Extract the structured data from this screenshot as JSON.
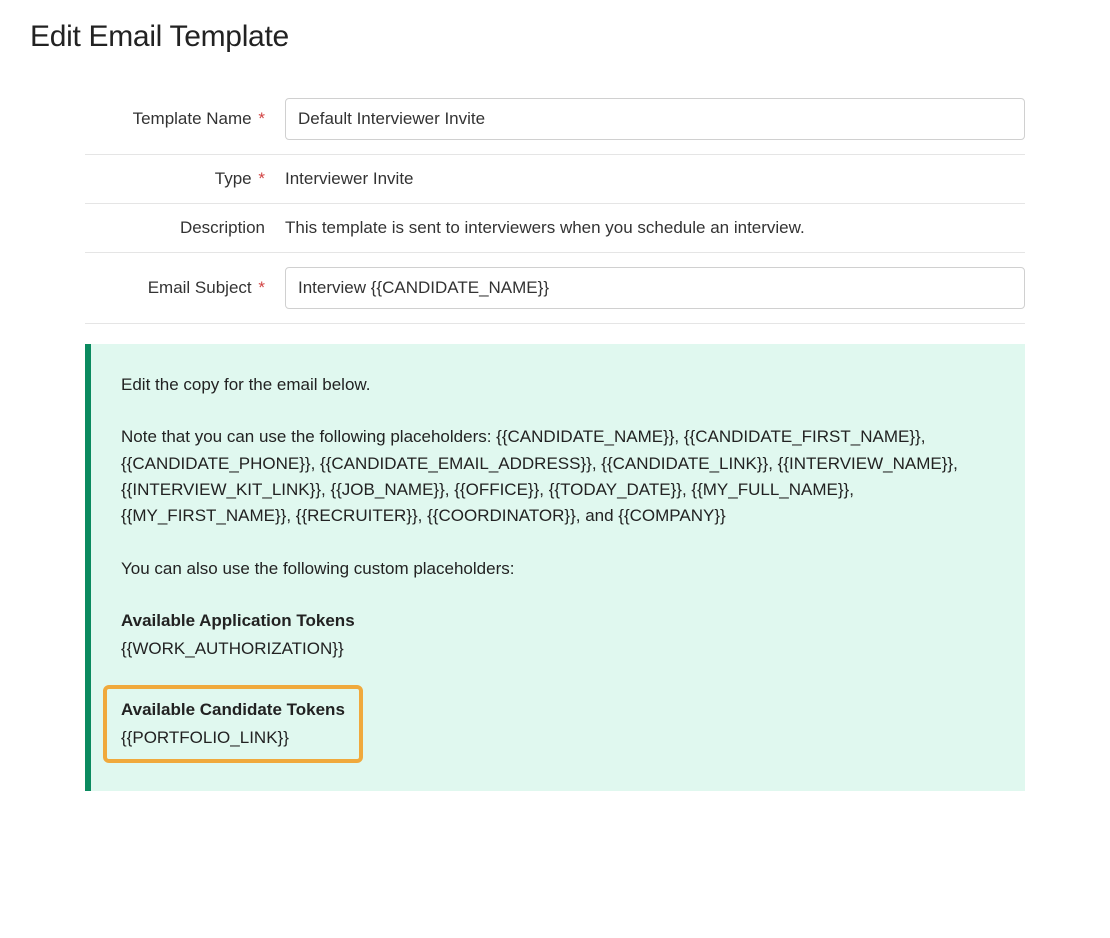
{
  "page": {
    "title": "Edit Email Template"
  },
  "form": {
    "templateName": {
      "label": "Template Name",
      "required": "*",
      "value": "Default Interviewer Invite"
    },
    "type": {
      "label": "Type",
      "required": "*",
      "value": "Interviewer Invite"
    },
    "description": {
      "label": "Description",
      "value": "This template is sent to interviewers when you schedule an interview."
    },
    "emailSubject": {
      "label": "Email Subject",
      "required": "*",
      "value": "Interview {{CANDIDATE_NAME}}"
    }
  },
  "infoBox": {
    "intro": "Edit the copy for the email below.",
    "placeholdersNote": "Note that you can use the following placeholders: {{CANDIDATE_NAME}}, {{CANDIDATE_FIRST_NAME}}, {{CANDIDATE_PHONE}}, {{CANDIDATE_EMAIL_ADDRESS}}, {{CANDIDATE_LINK}}, {{INTERVIEW_NAME}}, {{INTERVIEW_KIT_LINK}}, {{JOB_NAME}}, {{OFFICE}}, {{TODAY_DATE}}, {{MY_FULL_NAME}}, {{MY_FIRST_NAME}}, {{RECRUITER}}, {{COORDINATOR}}, and {{COMPANY}}",
    "customNote": "You can also use the following custom placeholders:",
    "applicationTokens": {
      "header": "Available Application Tokens",
      "value": "{{WORK_AUTHORIZATION}}"
    },
    "candidateTokens": {
      "header": "Available Candidate Tokens",
      "value": "{{PORTFOLIO_LINK}}"
    }
  }
}
